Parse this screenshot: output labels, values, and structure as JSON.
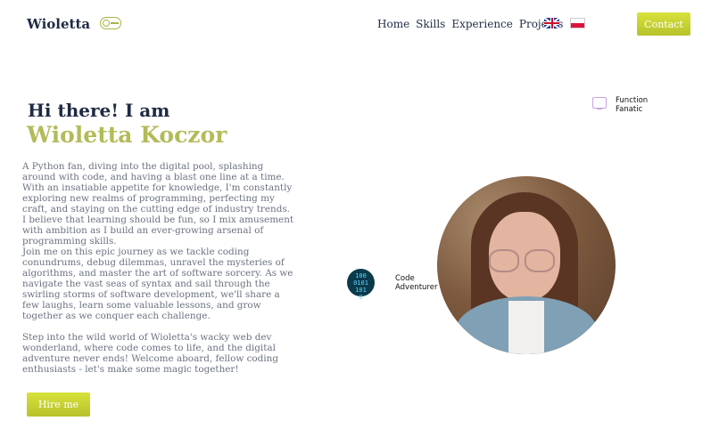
{
  "nav": {
    "logo": "Wioletta",
    "links": [
      "Home",
      "Skills",
      "Experience",
      "Projects"
    ],
    "contact_label": "Contact"
  },
  "hero": {
    "greeting": "Hi there! I am",
    "name": "Wioletta Koczor",
    "bio": [
      "A Python fan, diving into the digital pool, splashing around with code, and having a blast one line at a time. With an insatiable appetite for knowledge, I'm constantly exploring new realms of programming, perfecting my craft, and staying on the cutting edge of industry trends. I believe that learning should be fun, so I mix amusement with ambition as I build an ever-growing arsenal of programming skills.",
      "Join me on this epic journey as we tackle coding conundrums, debug dilemmas, unravel the mysteries of algorithms, and master the art of software sorcery. As we navigate the vast seas of syntax and sail through the swirling storms of software development, we'll share a few laughs, learn some valuable lessons, and grow together as we conquer each challenge.",
      "Step into the wild world of Wioletta's wacky web dev wonderland, where code comes to life, and the digital adventure never ends! Welcome aboard, fellow coding enthusiasts - let's make some magic together!"
    ],
    "hire_label": "Hire me"
  },
  "badges": {
    "function_fanatic": [
      "Function",
      "Fanatic"
    ],
    "code_adventurer": [
      "Code",
      "Adventurer"
    ],
    "binary_glyph": [
      "100",
      "0101",
      "101",
      "0"
    ]
  },
  "colors": {
    "accent": "#b3bb58",
    "button": "#c9d232",
    "text_dark": "#1f2a44",
    "text_body": "#6b7280"
  },
  "icons": {
    "theme_toggle": "toggle-icon",
    "flag_en": "uk-flag-icon",
    "flag_pl": "poland-flag-icon",
    "badge1": "monitor-icon",
    "badge2": "binary-code-icon"
  }
}
